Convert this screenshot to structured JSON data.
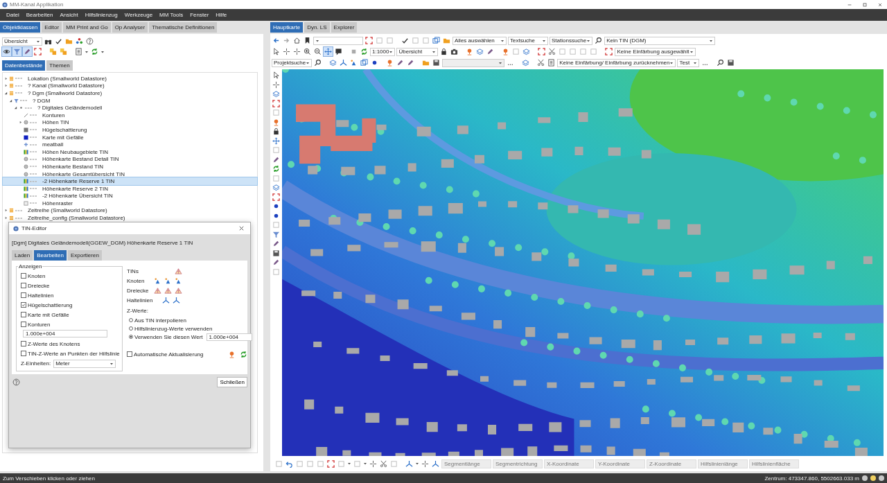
{
  "window": {
    "title": "MM-Kanal Applikation"
  },
  "menu": [
    "Datei",
    "Bearbeiten",
    "Ansicht",
    "Hilfslinienzug",
    "Werkzeuge",
    "MM Tools",
    "Fenster",
    "Hilfe"
  ],
  "left_tabs": [
    {
      "label": "Objektklassen",
      "selected": true
    },
    {
      "label": "Editor",
      "selected": false
    },
    {
      "label": "MM Print and Go",
      "selected": false
    },
    {
      "label": "Op Analyser",
      "selected": false
    },
    {
      "label": "Thematische Definitionen",
      "selected": false
    }
  ],
  "left_toolbar": {
    "view": "Übersicht"
  },
  "data_tabs": [
    {
      "label": "Datenbestände",
      "selected": true
    },
    {
      "label": "Themen",
      "selected": false
    }
  ],
  "tree": [
    {
      "label": "Lokation (Smallworld Datastore)",
      "kind": "datastore",
      "expanded": false,
      "selected": false
    },
    {
      "label": "? Kanal (Smallworld Datastore)",
      "kind": "datastore",
      "expanded": false,
      "selected": false
    },
    {
      "label": "? Dgm (Smallworld Datastore)",
      "kind": "datastore",
      "expanded": true,
      "selected": false,
      "children": [
        {
          "label": "? DGM",
          "kind": "filter",
          "expanded": true,
          "selected": false,
          "children": [
            {
              "label": "? Digitales Geländemodell",
              "kind": "group",
              "expanded": true,
              "selected": false,
              "children": [
                {
                  "label": "Konturen",
                  "kind": "line",
                  "selected": false
                },
                {
                  "label": "Höhen TIN",
                  "kind": "tin",
                  "expanded": false,
                  "selected": false
                },
                {
                  "label": "Hügelschattierung",
                  "kind": "grey",
                  "selected": false
                },
                {
                  "label": "Karte mit Gefälle",
                  "kind": "blue",
                  "selected": false
                },
                {
                  "label": "meatball",
                  "kind": "plus",
                  "selected": false
                },
                {
                  "label": "Höhen Neubaugebiete TIN",
                  "kind": "rainbow",
                  "selected": false
                },
                {
                  "label": "Höhenkarte Bestand Detail TIN",
                  "kind": "tin",
                  "selected": false
                },
                {
                  "label": "Höhenkarte Bestand TIN",
                  "kind": "tin",
                  "selected": false
                },
                {
                  "label": "Höhenkarte Gesamtübersicht TIN",
                  "kind": "tin",
                  "selected": false
                },
                {
                  "label": "-2 Höhenkarte Reserve 1 TIN",
                  "kind": "rainbow",
                  "selected": true
                },
                {
                  "label": "Höhenkarte Reserve 2 TIN",
                  "kind": "rainbow",
                  "selected": false
                },
                {
                  "label": "-2 Höhenkarte Übersicht TIN",
                  "kind": "rainbow",
                  "selected": false
                },
                {
                  "label": "Höhenraster",
                  "kind": "raster",
                  "selected": false
                }
              ]
            }
          ]
        }
      ]
    },
    {
      "label": "Zeitreihe (Smallworld Datastore)",
      "kind": "datastore",
      "expanded": false,
      "selected": false
    },
    {
      "label": "Zeitreihe_config (Smallworld Datastore)",
      "kind": "datastore",
      "expanded": false,
      "selected": false
    }
  ],
  "tin_editor": {
    "title": "TIN-Editor",
    "subtitle": "[Dgm] Digitales Geländemodell(GGEW_DGM) Höhenkarte Reserve 1 TIN",
    "tabs": [
      {
        "label": "Laden",
        "selected": false
      },
      {
        "label": "Bearbeiten",
        "selected": true
      },
      {
        "label": "Exportieren",
        "selected": false
      }
    ],
    "display": {
      "legend": "Anzeigen",
      "options": [
        {
          "label": "Knoten",
          "checked": false
        },
        {
          "label": "Dreiecke",
          "checked": false
        },
        {
          "label": "Haltelinien",
          "checked": false
        },
        {
          "label": "Hügelschattierung",
          "checked": true
        },
        {
          "label": "Karte mit Gefälle",
          "checked": false
        },
        {
          "label": "Konturen",
          "checked": false
        }
      ],
      "contour_value": "1.000e+004",
      "extra_options": [
        {
          "label": "Z-Werte des Knotens",
          "checked": false
        },
        {
          "label": "TIN-Z-Werte an Punkten der Hilfslinie",
          "checked": false
        }
      ],
      "units_label": "Z-Einheiten:",
      "units": "Meter"
    },
    "tools": [
      {
        "label": "TINs"
      },
      {
        "label": "Knoten"
      },
      {
        "label": "Dreiecke"
      },
      {
        "label": "Haltelinien"
      }
    ],
    "z_values": {
      "label": "Z-Werte:",
      "options": [
        {
          "label": "Aus TIN interpolieren",
          "selected": false
        },
        {
          "label": "Hilfslinienzug-Werte verwenden",
          "selected": false
        },
        {
          "label": "Verwenden Sie diesen Wert",
          "selected": true
        }
      ],
      "value": "1.000e+004"
    },
    "auto_update": {
      "label": "Automatische Aktualisierung",
      "checked": false
    },
    "close": "Schließen"
  },
  "right_tabs": [
    {
      "label": "Hauptkarte",
      "selected": true
    },
    {
      "label": "Dyn. LS",
      "selected": false
    },
    {
      "label": "Explorer",
      "selected": false
    }
  ],
  "map_toolbar": {
    "select_all": "Alles auswählen",
    "text_search": "Textsuche",
    "station_search": "Stationssuche",
    "tin": "Kein TIN (DGM)",
    "scale": "1:1000",
    "view": "Übersicht",
    "coloring": "Keine Einfärbung ausgewählt",
    "project_search": "Projektsuche",
    "reset_coloring": "Keine Einfärbung/ Einfärbung zurücknehmen",
    "profile": "Test"
  },
  "measure_fields": [
    {
      "label": "Segmentlänge"
    },
    {
      "label": "Segmentrichtung"
    },
    {
      "label": "X-Koordinate"
    },
    {
      "label": "Y-Koordinate"
    },
    {
      "label": "Z-Koordinate"
    },
    {
      "label": "Hilfslinienlänge"
    },
    {
      "label": "Hilfslinienfläche"
    }
  ],
  "status_bar": {
    "message": "Zum Verschieben klicken oder ziehen",
    "center": "Zentrum: 473347.860, 5502663.033 m",
    "indicators": [
      {
        "color": "#c8c8c8"
      },
      {
        "color": "#f0d060"
      },
      {
        "color": "#c8c8c8"
      }
    ]
  }
}
